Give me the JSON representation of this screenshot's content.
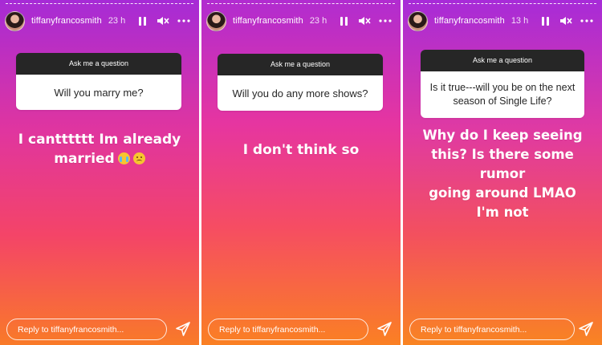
{
  "stories": [
    {
      "username": "tiffanyfrancosmith",
      "time": "23 h",
      "question_header": "Ask me a question",
      "question": "Will you marry me?",
      "answer_lines": [
        "I cantttttt Im already",
        "married"
      ],
      "answer_emojis": [
        "crying-face-emoji",
        "sad-face-emoji"
      ],
      "reply_placeholder": "Reply to tiffanyfrancosmith..."
    },
    {
      "username": "tiffanyfrancosmith",
      "time": "23 h",
      "question_header": "Ask me a question",
      "question": "Will you do any more shows?",
      "answer_lines": [
        "I don't think so"
      ],
      "reply_placeholder": "Reply to tiffanyfrancosmith..."
    },
    {
      "username": "tiffanyfrancosmith",
      "time": "13 h",
      "question_header": "Ask me a question",
      "question_lines": [
        "Is it true---will you be on the next",
        "season of Single Life?"
      ],
      "answer_lines": [
        "Why do I keep seeing",
        "this? Is there some rumor",
        "going around LMAO",
        "I'm not"
      ],
      "reply_placeholder": "Reply to tiffanyfrancosmith..."
    }
  ],
  "icons": {
    "pause": "pause-icon",
    "mute": "mute-icon",
    "more": "more-icon",
    "send": "send-icon"
  }
}
